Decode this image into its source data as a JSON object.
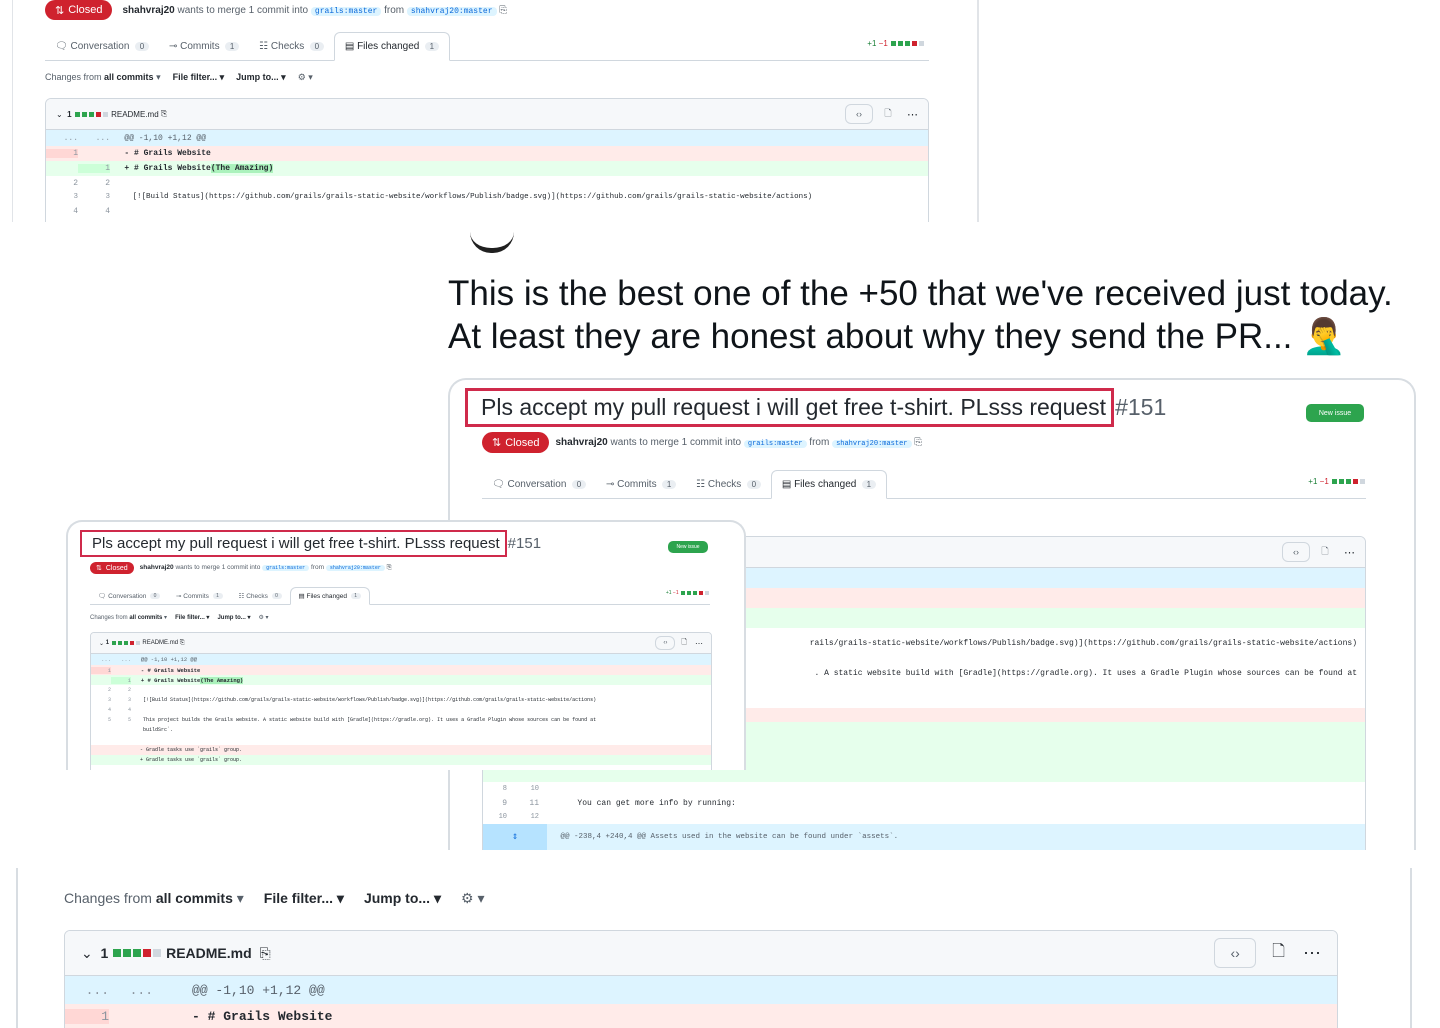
{
  "pr": {
    "title": "Pls accept my pull request i will get free t-shirt. PLsss request",
    "number": "#151",
    "status": "Closed",
    "author": "shahvraj20",
    "merge_text": "wants to merge 1 commit into",
    "base_branch": "grails:master",
    "from": "from",
    "head_branch": "shahvraj20:master",
    "new_issue": "New issue"
  },
  "tabs": [
    {
      "label": "Conversation",
      "count": "0"
    },
    {
      "label": "Commits",
      "count": "1"
    },
    {
      "label": "Checks",
      "count": "0"
    },
    {
      "label": "Files changed",
      "count": "1"
    }
  ],
  "diffstat": {
    "plus": "+1",
    "minus": "−1"
  },
  "toolbar": {
    "changes_from": "Changes from",
    "all_commits": "all commits",
    "file_filter": "File filter...",
    "jump_to": "Jump to..."
  },
  "file": {
    "count": "1",
    "name": "README.md"
  },
  "diff": {
    "hunk1": "@@ -1,10 +1,12 @@",
    "del1": "- # Grails Website",
    "add1_prefix": "+ # Grails Website ",
    "add1_hl": "(The Amazing)",
    "build_status": "[![Build Status](https://github.com/grails/grails-static-website/workflows/Publish/badge.svg)](https://github.com/grails/grails-static-website/actions)",
    "build_status_tail": "rails/grails-static-website/workflows/Publish/badge.svg)](https://github.com/grails/grails-static-website/actions)",
    "project_line": "This project builds the Grails website. A static website build with [Gradle](https://gradle.org). It uses a Gradle Plugin whose sources can be found at",
    "project_line_tail": ". A static website build with [Gradle](https://gradle.org). It uses a Gradle Plugin whose sources can be found at",
    "buildsrc": "buildSrc`.",
    "gradle_del": "- Gradle tasks use `grails` group.",
    "gradle_add": "+ Gradle tasks use `grails` group.",
    "more_info": "You can get more info by running:",
    "hunk2": "@@ -238,4 +240,4 @@ Assets used in the website can be found under `assets`."
  },
  "line_numbers": {
    "l1": "1",
    "l2": "2",
    "l3": "3",
    "l4": "4",
    "l5": "5",
    "n8": "8",
    "n9": "9",
    "n10": "10",
    "n11": "11",
    "n12": "12",
    "dots": "..."
  },
  "tweet": {
    "line1": "This is the best one of the +50 that we've received just today.",
    "line2": "At least they are honest about why they send the PR...",
    "emoji": "🤦‍♂️"
  },
  "colors": {
    "closed": "#cf222e",
    "highlight_box": "#cf2a4b",
    "add_bg": "#e6ffec",
    "del_bg": "#ffebe9",
    "hunk_bg": "#ddf4ff",
    "new_issue": "#2da44e"
  }
}
